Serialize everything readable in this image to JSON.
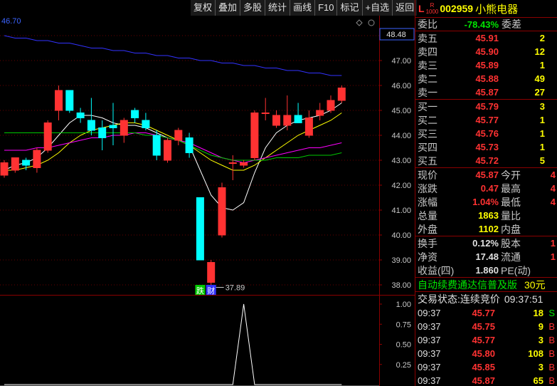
{
  "toolbar": [
    "复权",
    "叠加",
    "多股",
    "统计",
    "画线",
    "F10",
    "标记",
    "+自选",
    "返回"
  ],
  "chart": {
    "top_left_value": "46.70",
    "price_tag": "48.48",
    "low_marker": "37.89",
    "price_ticks": [
      "48.00",
      "47.00",
      "46.00",
      "45.00",
      "44.00",
      "43.00",
      "42.00",
      "41.00",
      "40.00",
      "39.00",
      "38.00"
    ],
    "ind_ticks": [
      "1.00",
      "0.75",
      "0.50",
      "0.25"
    ],
    "badges": [
      "跌",
      "财"
    ],
    "colors": {
      "up": "#ff3232",
      "down": "#00ffff",
      "ma1": "#ffffff",
      "ma2": "#ffff00",
      "ma3": "#ff00ff",
      "ma4": "#00c800",
      "ma5": "#3232ff",
      "grid": "#8b0000"
    }
  },
  "chart_data": {
    "type": "candlestick",
    "ylim": [
      37.6,
      48.8
    ],
    "candles": [
      {
        "o": 42.4,
        "h": 43.0,
        "l": 42.3,
        "c": 42.9
      },
      {
        "o": 42.6,
        "h": 43.0,
        "l": 42.5,
        "c": 43.1
      },
      {
        "o": 43.0,
        "h": 43.1,
        "l": 42.6,
        "c": 42.8
      },
      {
        "o": 42.7,
        "h": 43.5,
        "l": 42.5,
        "c": 43.4
      },
      {
        "o": 43.4,
        "h": 44.6,
        "l": 43.3,
        "c": 44.5
      },
      {
        "o": 45.0,
        "h": 46.0,
        "l": 44.6,
        "c": 45.8
      },
      {
        "o": 45.8,
        "h": 45.8,
        "l": 44.9,
        "c": 45.0
      },
      {
        "o": 44.9,
        "h": 45.1,
        "l": 44.5,
        "c": 44.7
      },
      {
        "o": 44.6,
        "h": 45.5,
        "l": 44.0,
        "c": 44.2
      },
      {
        "o": 44.3,
        "h": 44.6,
        "l": 43.4,
        "c": 43.9
      },
      {
        "o": 44.4,
        "h": 45.3,
        "l": 43.6,
        "c": 44.3
      },
      {
        "o": 44.0,
        "h": 44.7,
        "l": 43.7,
        "c": 44.6
      },
      {
        "o": 45.0,
        "h": 45.1,
        "l": 44.5,
        "c": 44.7
      },
      {
        "o": 44.6,
        "h": 44.9,
        "l": 44.2,
        "c": 44.3
      },
      {
        "o": 44.0,
        "h": 44.2,
        "l": 43.0,
        "c": 43.2
      },
      {
        "o": 43.0,
        "h": 43.9,
        "l": 42.9,
        "c": 43.8
      },
      {
        "o": 43.8,
        "h": 44.3,
        "l": 43.6,
        "c": 44.2
      },
      {
        "o": 43.9,
        "h": 44.1,
        "l": 43.1,
        "c": 43.3
      },
      {
        "o": 41.5,
        "h": 41.5,
        "l": 39.0,
        "c": 39.0
      },
      {
        "o": 38.1,
        "h": 39.0,
        "l": 37.9,
        "c": 38.9
      },
      {
        "o": 40.0,
        "h": 42.1,
        "l": 39.9,
        "c": 41.9
      },
      {
        "o": 42.9,
        "h": 43.2,
        "l": 42.2,
        "c": 42.9
      },
      {
        "o": 42.8,
        "h": 43.0,
        "l": 42.7,
        "c": 42.9
      },
      {
        "o": 43.1,
        "h": 45.0,
        "l": 43.0,
        "c": 44.9
      },
      {
        "o": 44.9,
        "h": 45.5,
        "l": 44.6,
        "c": 44.9
      },
      {
        "o": 44.4,
        "h": 45.0,
        "l": 44.3,
        "c": 44.8
      },
      {
        "o": 44.4,
        "h": 45.6,
        "l": 44.2,
        "c": 44.8
      },
      {
        "o": 44.8,
        "h": 45.3,
        "l": 44.5,
        "c": 44.5
      },
      {
        "o": 44.0,
        "h": 45.0,
        "l": 43.9,
        "c": 44.7
      },
      {
        "o": 44.8,
        "h": 45.3,
        "l": 44.6,
        "c": 45.0
      },
      {
        "o": 45.0,
        "h": 45.6,
        "l": 44.9,
        "c": 45.4
      },
      {
        "o": 45.4,
        "h": 46.0,
        "l": 45.3,
        "c": 45.9
      }
    ],
    "ma_lines": [
      {
        "color": "#ffffff",
        "values": [
          42.6,
          42.8,
          42.9,
          43.1,
          43.5,
          44.0,
          44.5,
          44.8,
          44.8,
          44.7,
          44.5,
          44.4,
          44.4,
          44.3,
          44.1,
          43.9,
          43.8,
          43.6,
          42.6,
          41.6,
          41.1,
          41.0,
          41.3,
          42.5,
          43.5,
          44.1,
          44.4,
          44.6,
          44.7,
          44.8,
          45.0,
          45.3
        ]
      },
      {
        "color": "#ffff00",
        "values": [
          42.6,
          42.6,
          42.7,
          42.8,
          43.0,
          43.3,
          43.7,
          44.0,
          44.2,
          44.3,
          44.4,
          44.5,
          44.5,
          44.4,
          44.2,
          44.0,
          43.8,
          43.6,
          43.3,
          43.0,
          42.8,
          42.6,
          42.6,
          42.8,
          43.1,
          43.4,
          43.7,
          44.0,
          44.2,
          44.4,
          44.6,
          44.9
        ]
      },
      {
        "color": "#ff00ff",
        "values": [
          43.4,
          43.4,
          43.4,
          43.5,
          43.5,
          43.6,
          43.7,
          43.8,
          43.9,
          43.9,
          44.0,
          44.0,
          44.1,
          44.1,
          44.0,
          43.9,
          43.8,
          43.7,
          43.5,
          43.3,
          43.1,
          43.0,
          42.9,
          43.0,
          43.1,
          43.2,
          43.3,
          43.4,
          43.5,
          43.5,
          43.6,
          43.7
        ]
      },
      {
        "color": "#00c800",
        "values": [
          44.1,
          44.1,
          44.1,
          44.1,
          44.1,
          44.1,
          44.1,
          44.1,
          44.1,
          44.1,
          44.1,
          44.1,
          44.1,
          44.0,
          44.0,
          43.9,
          43.8,
          43.6,
          43.4,
          43.2,
          43.1,
          43.0,
          43.0,
          43.0,
          43.0,
          43.1,
          43.1,
          43.1,
          43.2,
          43.2,
          43.2,
          43.3
        ]
      },
      {
        "color": "#3232ff",
        "values": [
          48.0,
          47.9,
          47.9,
          47.8,
          47.8,
          47.7,
          47.7,
          47.6,
          47.5,
          47.5,
          47.4,
          47.4,
          47.3,
          47.3,
          47.2,
          47.2,
          47.1,
          47.1,
          47.0,
          47.0,
          46.9,
          46.9,
          46.8,
          46.8,
          46.7,
          46.7,
          46.6,
          46.6,
          46.5,
          46.5,
          46.4,
          46.4
        ]
      }
    ],
    "indicator": {
      "ylim": [
        0,
        1
      ],
      "values": [
        0,
        0,
        0,
        0,
        0,
        0,
        0,
        0,
        0,
        0,
        0,
        0,
        0,
        0,
        0,
        0,
        0,
        0,
        0,
        0,
        0,
        0,
        1,
        0,
        0,
        0,
        0,
        0,
        0,
        0,
        0,
        0
      ]
    }
  },
  "stock": {
    "l_mark": "L",
    "r_mark": "R",
    "r_sub": "1000",
    "code": "002959",
    "name": "小熊电器"
  },
  "ratio": {
    "label": "委比",
    "value": "-78.43%",
    "label2": "委差"
  },
  "asks": [
    {
      "label": "卖五",
      "price": "45.91",
      "vol": "2"
    },
    {
      "label": "卖四",
      "price": "45.90",
      "vol": "12"
    },
    {
      "label": "卖三",
      "price": "45.89",
      "vol": "1"
    },
    {
      "label": "卖二",
      "price": "45.88",
      "vol": "49"
    },
    {
      "label": "卖一",
      "price": "45.87",
      "vol": "27"
    }
  ],
  "bids": [
    {
      "label": "买一",
      "price": "45.79",
      "vol": "3"
    },
    {
      "label": "买二",
      "price": "45.77",
      "vol": "1"
    },
    {
      "label": "买三",
      "price": "45.76",
      "vol": "1"
    },
    {
      "label": "买四",
      "price": "45.73",
      "vol": "1"
    },
    {
      "label": "买五",
      "price": "45.72",
      "vol": "5"
    }
  ],
  "quote1": [
    {
      "l": "现价",
      "v": "45.87",
      "c": "red",
      "l2": "今开",
      "v2": "4"
    },
    {
      "l": "涨跌",
      "v": "0.47",
      "c": "red",
      "l2": "最高",
      "v2": "4"
    },
    {
      "l": "涨幅",
      "v": "1.04%",
      "c": "red",
      "l2": "最低",
      "v2": "4"
    },
    {
      "l": "总量",
      "v": "1863",
      "c": "yellow",
      "l2": "量比",
      "v2": ""
    },
    {
      "l": "外盘",
      "v": "1102",
      "c": "yellow",
      "l2": "内盘",
      "v2": ""
    }
  ],
  "quote2": [
    {
      "l": "换手",
      "v": "0.12%",
      "c": "white",
      "l2": "股本",
      "v2": "1"
    },
    {
      "l": "净资",
      "v": "17.48",
      "c": "white",
      "l2": "流通",
      "v2": "1"
    },
    {
      "l": "收益(四)",
      "v": "1.860",
      "c": "white",
      "l2": "PE(动)",
      "v2": ""
    }
  ],
  "promo": {
    "text": "自动续费通达信普及版",
    "price": "30元"
  },
  "status": {
    "label": "交易状态:",
    "value": "连续竞价",
    "time": "09:37:51"
  },
  "ticks": [
    {
      "t": "09:37",
      "p": "45.77",
      "v": "18",
      "d": "S",
      "dc": "green"
    },
    {
      "t": "09:37",
      "p": "45.75",
      "v": "9",
      "d": "B",
      "dc": "red"
    },
    {
      "t": "09:37",
      "p": "45.77",
      "v": "3",
      "d": "B",
      "dc": "red"
    },
    {
      "t": "09:37",
      "p": "45.80",
      "v": "108",
      "d": "B",
      "dc": "red"
    },
    {
      "t": "09:37",
      "p": "45.85",
      "v": "3",
      "d": "B",
      "dc": "red"
    },
    {
      "t": "09:37",
      "p": "45.87",
      "v": "65",
      "d": "B",
      "dc": "red"
    }
  ]
}
